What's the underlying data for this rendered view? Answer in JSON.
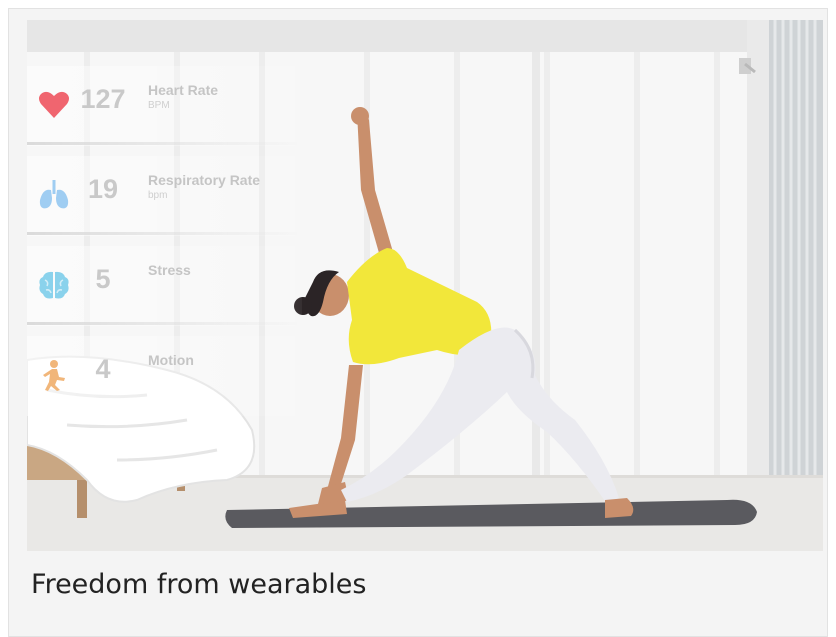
{
  "caption": "Freedom from wearables",
  "metrics": [
    {
      "value": "127",
      "label": "Heart Rate",
      "unit": "BPM",
      "icon": "heart-icon",
      "icon_color": "#f0656f"
    },
    {
      "value": "19",
      "label": "Respiratory Rate",
      "unit": "bpm",
      "icon": "lungs-icon",
      "icon_color": "#9fcdf2"
    },
    {
      "value": "5",
      "label": "Stress",
      "unit": "",
      "icon": "brain-icon",
      "icon_color": "#8ad2ec"
    },
    {
      "value": "4",
      "label": "Motion",
      "unit": "",
      "icon": "person-motion-icon",
      "icon_color": "#f1b67a"
    }
  ],
  "colors": {
    "shirt": "#f2e73a",
    "mat": "#5a5a5f",
    "leggings": "#ebebf0",
    "hair": "#2b2426",
    "skin": "#c98f6c"
  }
}
